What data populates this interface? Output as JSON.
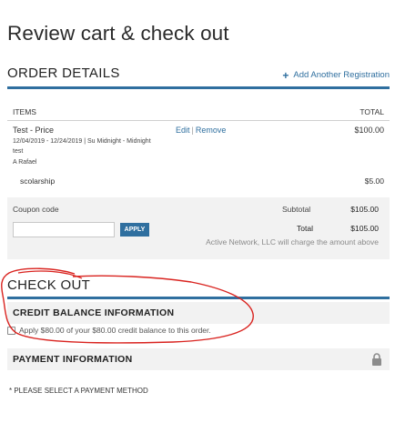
{
  "page": {
    "title": "Review cart & check out"
  },
  "order_details": {
    "heading": "ORDER DETAILS",
    "add_link": "Add Another Registration",
    "items_header": "ITEMS",
    "total_header": "TOTAL",
    "item": {
      "name": "Test - Price",
      "edit": "Edit",
      "remove": "Remove",
      "separator": "|",
      "price": "$100.00",
      "dates": "12/04/2019 - 12/24/2019 | Su Midnight - Midnight",
      "line2": "test",
      "participant": "A Rafael"
    },
    "discount": {
      "label": "scolarship",
      "amount": "$5.00"
    },
    "coupon_label": "Coupon code",
    "coupon_value": "",
    "coupon_placeholder": "",
    "apply_label": "APPLY",
    "subtotal_label": "Subtotal",
    "subtotal_value": "$105.00",
    "total_label": "Total",
    "total_value": "$105.00",
    "charge_note": "Active Network, LLC will charge the amount above"
  },
  "checkout": {
    "heading": "CHECK OUT",
    "credit_heading": "CREDIT BALANCE INFORMATION",
    "credit_text": "Apply $80.00 of your $80.00 credit balance to this order.",
    "credit_checked": false,
    "payment_heading": "PAYMENT INFORMATION",
    "payment_note": "* PLEASE SELECT A PAYMENT METHOD"
  },
  "icons": {
    "add": "plus-icon",
    "lock": "lock-icon"
  },
  "colors": {
    "accent": "#2f6f9f",
    "annotation": "#d9231f",
    "panel": "#f2f2f2"
  }
}
